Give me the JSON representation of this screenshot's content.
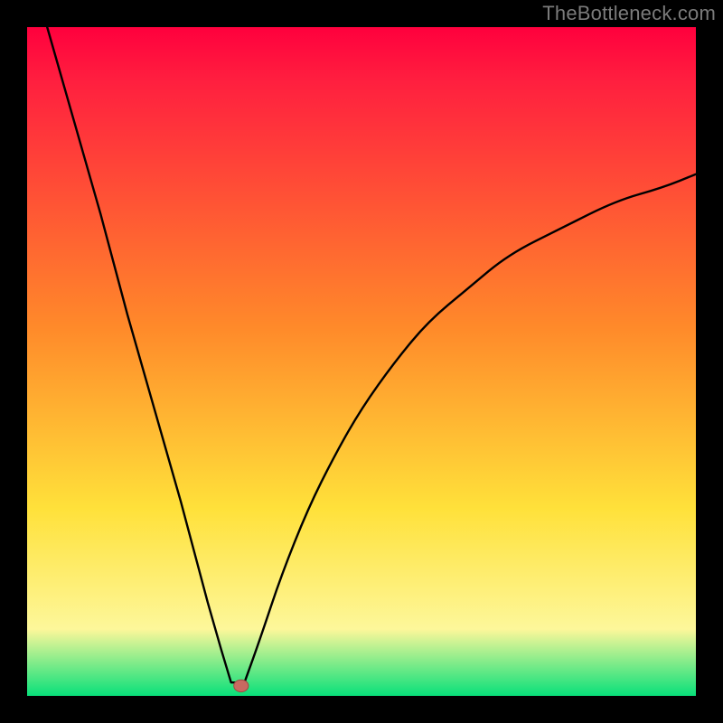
{
  "watermark": "TheBottleneck.com",
  "colors": {
    "top": "#ff003d",
    "red": "#ff1f3f",
    "orange": "#ff8a2a",
    "yellow": "#ffe13a",
    "paleyellow": "#fdf79a",
    "green": "#08e07a",
    "black": "#000000",
    "curve": "#000000",
    "dot_fill": "#c96a61",
    "dot_stroke": "#9e4a42"
  },
  "chart_data": {
    "type": "line",
    "title": "",
    "xlabel": "",
    "ylabel": "",
    "xlim": [
      0,
      100
    ],
    "ylim": [
      0,
      100
    ],
    "notes": "Bottleneck-style V curve on a red→yellow→green vertical gradient. Minimum near x≈31. Left branch steep and nearly linear from top-left to the notch; right branch curved rising toward upper-right, ending near y≈78 at x=100. Small rounded marker at the minimum.",
    "series": [
      {
        "name": "left-branch",
        "x": [
          3,
          7,
          11,
          15,
          19,
          23,
          27,
          29,
          30.5
        ],
        "y": [
          100,
          86,
          72,
          57,
          43,
          29,
          14,
          7,
          2
        ]
      },
      {
        "name": "notch",
        "x": [
          30.5,
          32.5
        ],
        "y": [
          2,
          2
        ]
      },
      {
        "name": "right-branch",
        "x": [
          32.5,
          35,
          38,
          42,
          46,
          50,
          55,
          60,
          66,
          72,
          80,
          88,
          95,
          100
        ],
        "y": [
          2,
          9,
          18,
          28,
          36,
          43,
          50,
          56,
          61,
          66,
          70,
          74,
          76,
          78
        ]
      }
    ],
    "marker": {
      "x": 32,
      "y": 1.5,
      "rx": 1.1,
      "ry": 0.9
    }
  }
}
